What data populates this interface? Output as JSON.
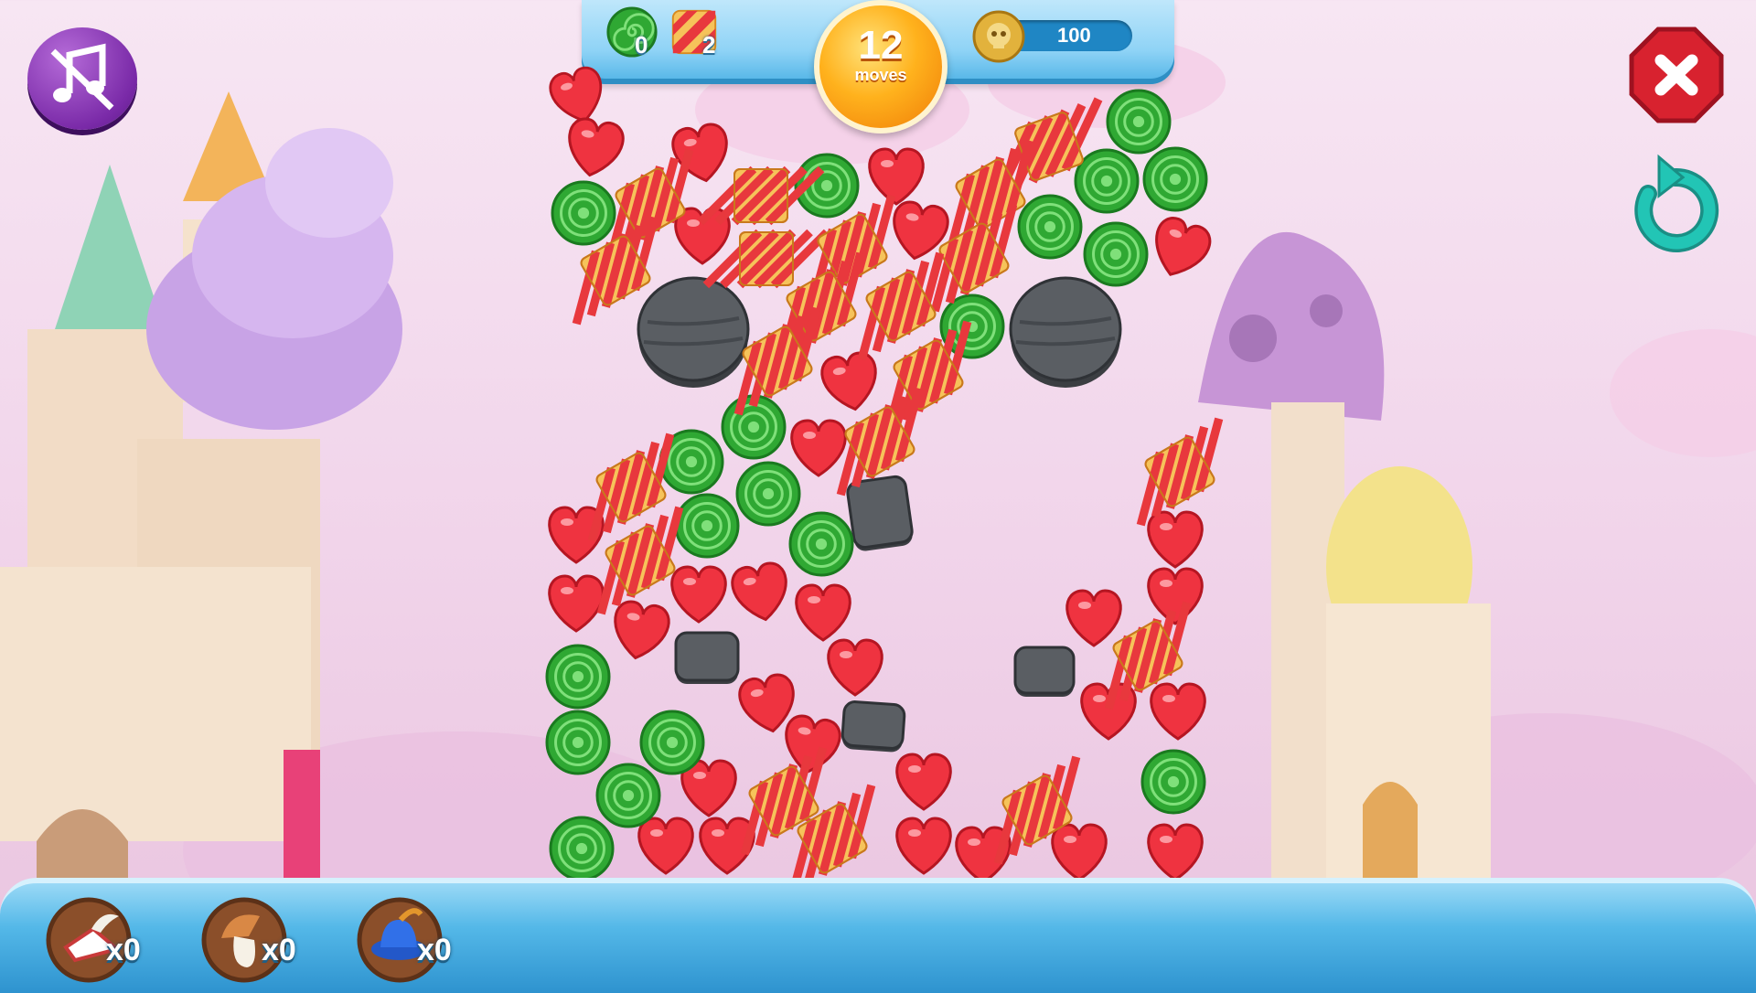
{
  "hud": {
    "goals": [
      {
        "icon": "green-swirl-candy-icon",
        "count": "0"
      },
      {
        "icon": "striped-candy-icon",
        "count": "2"
      }
    ],
    "moves_number": "12",
    "moves_label": "moves",
    "coins": "100",
    "coin_icon": "skull-coin-icon"
  },
  "controls": {
    "music_icon": "music-muted-icon",
    "close_icon": "close-icon",
    "restart_icon": "restart-icon"
  },
  "boosters": [
    {
      "icon": "winged-shoe-icon",
      "count": "x0"
    },
    {
      "icon": "mushroom-icon",
      "count": "x0"
    },
    {
      "icon": "blue-hat-icon",
      "count": "x0"
    }
  ],
  "colors": {
    "heart_red": "#ef3340",
    "swirl_green": "#2fa833",
    "stripe_red": "#e8383d",
    "stripe_yellow": "#f6c35a",
    "stone_gray": "#5a5e63",
    "moves_orange": "#f7a21b",
    "close_red": "#d8222f",
    "restart_teal": "#1fbfb0"
  }
}
